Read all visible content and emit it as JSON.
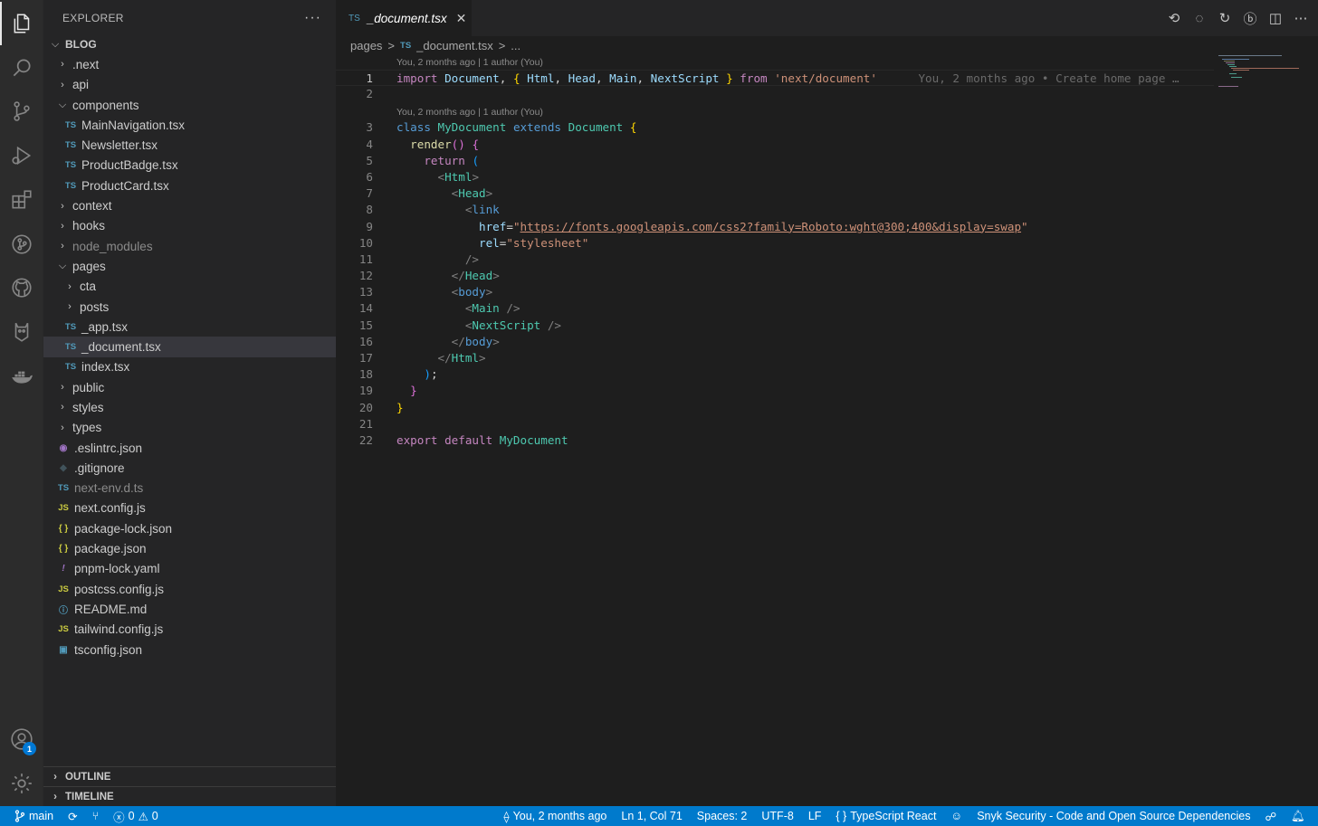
{
  "explorer": {
    "title": "EXPLORER",
    "more": "···",
    "root": "BLOG",
    "items": [
      {
        "label": ".next",
        "type": "folder",
        "open": false,
        "depth": 1,
        "dim": false
      },
      {
        "label": "api",
        "type": "folder",
        "open": false,
        "depth": 1,
        "dim": false
      },
      {
        "label": "components",
        "type": "folder",
        "open": true,
        "depth": 1,
        "dim": false
      },
      {
        "label": "MainNavigation.tsx",
        "type": "ts",
        "depth": 2
      },
      {
        "label": "Newsletter.tsx",
        "type": "ts",
        "depth": 2
      },
      {
        "label": "ProductBadge.tsx",
        "type": "ts",
        "depth": 2
      },
      {
        "label": "ProductCard.tsx",
        "type": "ts",
        "depth": 2
      },
      {
        "label": "context",
        "type": "folder",
        "open": false,
        "depth": 1
      },
      {
        "label": "hooks",
        "type": "folder",
        "open": false,
        "depth": 1
      },
      {
        "label": "node_modules",
        "type": "folder",
        "open": false,
        "depth": 1,
        "dim": true
      },
      {
        "label": "pages",
        "type": "folder",
        "open": true,
        "depth": 1
      },
      {
        "label": "cta",
        "type": "folder",
        "open": false,
        "depth": 2
      },
      {
        "label": "posts",
        "type": "folder",
        "open": false,
        "depth": 2
      },
      {
        "label": "_app.tsx",
        "type": "ts",
        "depth": 2
      },
      {
        "label": "_document.tsx",
        "type": "ts",
        "depth": 2,
        "selected": true
      },
      {
        "label": "index.tsx",
        "type": "ts",
        "depth": 2
      },
      {
        "label": "public",
        "type": "folder",
        "open": false,
        "depth": 1
      },
      {
        "label": "styles",
        "type": "folder",
        "open": false,
        "depth": 1
      },
      {
        "label": "types",
        "type": "folder",
        "open": false,
        "depth": 1
      },
      {
        "label": ".eslintrc.json",
        "type": "eslint",
        "depth": 1
      },
      {
        "label": ".gitignore",
        "type": "git",
        "depth": 1
      },
      {
        "label": "next-env.d.ts",
        "type": "ts",
        "depth": 1,
        "dim": true
      },
      {
        "label": "next.config.js",
        "type": "js",
        "depth": 1
      },
      {
        "label": "package-lock.json",
        "type": "json",
        "depth": 1
      },
      {
        "label": "package.json",
        "type": "json",
        "depth": 1
      },
      {
        "label": "pnpm-lock.yaml",
        "type": "yaml",
        "depth": 1
      },
      {
        "label": "postcss.config.js",
        "type": "js",
        "depth": 1
      },
      {
        "label": "README.md",
        "type": "info",
        "depth": 1
      },
      {
        "label": "tailwind.config.js",
        "type": "js",
        "depth": 1
      },
      {
        "label": "tsconfig.json",
        "type": "tsconfig",
        "depth": 1
      }
    ],
    "outline": "OUTLINE",
    "timeline": "TIMELINE"
  },
  "tab": {
    "icon": "TS",
    "name": "_document.tsx",
    "close": "✕"
  },
  "breadcrumb": {
    "folder": "pages",
    "sep": ">",
    "icon": "TS",
    "file": "_document.tsx",
    "sep2": ">",
    "more": "..."
  },
  "codelens": {
    "line1": "You, 2 months ago | 1 author (You)",
    "line3": "You, 2 months ago | 1 author (You)"
  },
  "code": {
    "blame": "You, 2 months ago • Create home page …",
    "href_url": "https://fonts.googleapis.com/css2?family=Roboto:wght@300;400&display=swap"
  },
  "status": {
    "branch": "main",
    "errors": "0",
    "warnings": "0",
    "blame": "You, 2 months ago",
    "position": "Ln 1, Col 71",
    "spaces": "Spaces: 2",
    "encoding": "UTF-8",
    "eol": "LF",
    "language": "TypeScript React",
    "snyk": "Snyk Security - Code and Open Source Dependencies"
  },
  "accounts_badge": "1",
  "colors": {
    "accent": "#007acc",
    "sidebar": "#252526",
    "editor": "#1e1e1e"
  }
}
